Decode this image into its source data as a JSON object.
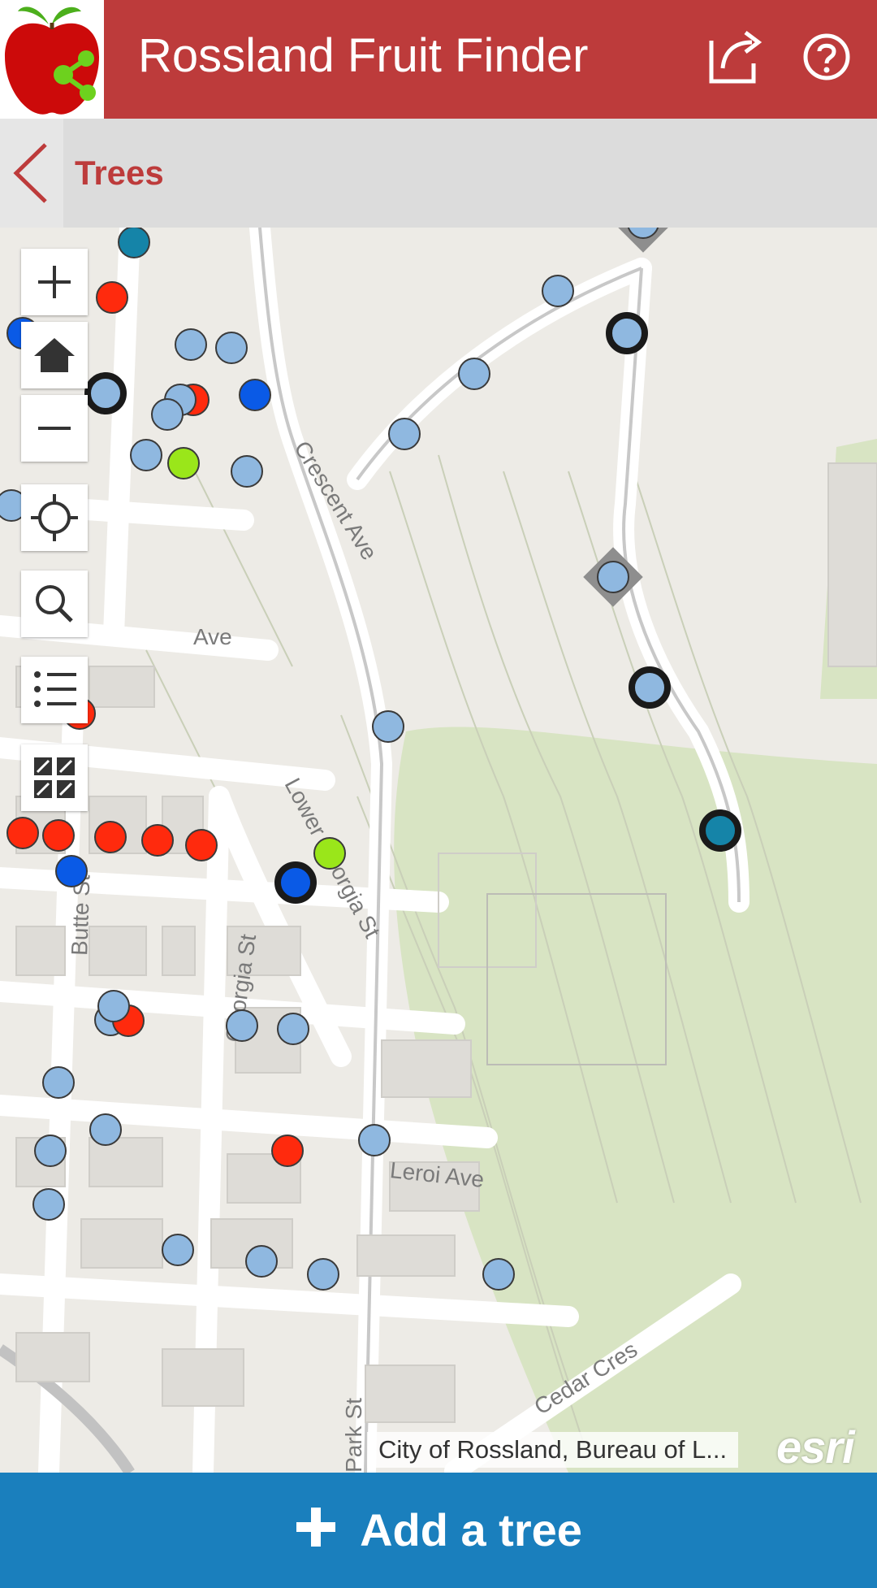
{
  "header": {
    "title": "Rossland Fruit Finder",
    "icons": [
      "apple-logo-icon",
      "share-icon",
      "help-icon"
    ],
    "background": "#bd3b3b"
  },
  "subbar": {
    "title": "Trees",
    "back_icon": "chevron-left-icon"
  },
  "map": {
    "street_labels": [
      "Crescent Ave",
      "Lower Georgia St",
      "Georgia St",
      "Butte St",
      "Leroi Ave",
      "Cedar Cres",
      "Park St",
      "Ave"
    ],
    "controls": [
      "zoom-in",
      "home",
      "zoom-out",
      "locate",
      "search",
      "legend",
      "basemap"
    ],
    "attribution": "City of Rossland, Bureau of L...",
    "provider": "esri",
    "marker_colors": {
      "light_blue": "#8fb8e0",
      "teal": "#1584a8",
      "red": "#ff2a0d",
      "green": "#9ae61a",
      "blue": "#0a5ae6"
    }
  },
  "footer": {
    "add_label": "Add a tree",
    "background": "#1a7fbd"
  }
}
